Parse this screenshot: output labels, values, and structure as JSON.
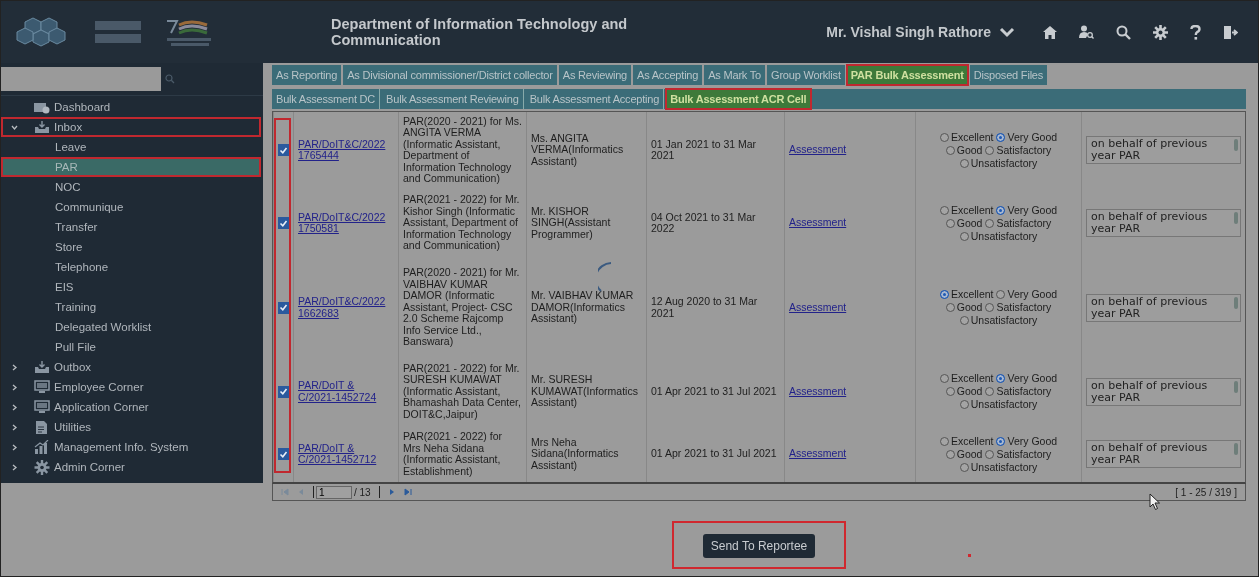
{
  "header": {
    "title": "Department of Information Technology and Communication",
    "user": "Mr. Vishal Singh Rathore"
  },
  "sidebar": {
    "items": [
      {
        "label": "Dashboard",
        "kind": "dashboard",
        "highlighted": false
      },
      {
        "label": "Inbox",
        "kind": "inbox",
        "expanded": true,
        "highlighted": true,
        "children": [
          {
            "label": "Leave",
            "selected": false,
            "highlighted": false
          },
          {
            "label": "PAR",
            "selected": true,
            "highlighted": true
          },
          {
            "label": "NOC",
            "selected": false,
            "highlighted": false
          },
          {
            "label": "Communique",
            "selected": false,
            "highlighted": false
          },
          {
            "label": "Transfer",
            "selected": false,
            "highlighted": false
          },
          {
            "label": "Store",
            "selected": false,
            "highlighted": false
          },
          {
            "label": "Telephone",
            "selected": false,
            "highlighted": false
          },
          {
            "label": "EIS",
            "selected": false,
            "highlighted": false
          },
          {
            "label": "Training",
            "selected": false,
            "highlighted": false
          },
          {
            "label": "Delegated Worklist",
            "selected": false,
            "highlighted": false
          },
          {
            "label": "Pull File",
            "selected": false,
            "highlighted": false
          }
        ]
      },
      {
        "label": "Outbox",
        "kind": "inbox",
        "expanded": false,
        "highlighted": false
      },
      {
        "label": "Employee Corner",
        "kind": "monitor",
        "expanded": false,
        "highlighted": false
      },
      {
        "label": "Application Corner",
        "kind": "monitor",
        "expanded": false,
        "highlighted": false
      },
      {
        "label": "Utilities",
        "kind": "document",
        "expanded": false,
        "highlighted": false
      },
      {
        "label": "Management Info. System",
        "kind": "chart",
        "expanded": false,
        "highlighted": false
      },
      {
        "label": "Admin Corner",
        "kind": "gear",
        "expanded": false,
        "highlighted": false
      }
    ]
  },
  "tabs": [
    {
      "label": "As Reporting",
      "selected": false,
      "highlighted": false
    },
    {
      "label": "As Divisional commissioner/District collector",
      "selected": false,
      "highlighted": false
    },
    {
      "label": "As Reviewing",
      "selected": false,
      "highlighted": false
    },
    {
      "label": "As Accepting",
      "selected": false,
      "highlighted": false
    },
    {
      "label": "As Mark To",
      "selected": false,
      "highlighted": false
    },
    {
      "label": "Group Worklist",
      "selected": false,
      "highlighted": false
    },
    {
      "label": "PAR Bulk Assessment",
      "selected": true,
      "highlighted": true
    },
    {
      "label": "Disposed Files",
      "selected": false,
      "highlighted": false
    }
  ],
  "subtabs": [
    {
      "label": "Bulk Assessment DC",
      "selected": false,
      "highlighted": false
    },
    {
      "label": "Bulk Assessment Reviewing",
      "selected": false,
      "highlighted": false
    },
    {
      "label": "Bulk Assessment Accepting",
      "selected": false,
      "highlighted": false
    },
    {
      "label": "Bulk Assessment ACR Cell",
      "selected": true,
      "highlighted": true
    }
  ],
  "table": {
    "checkbox_column_highlighted": true,
    "rows": [
      {
        "checked": true,
        "reference": "PAR/DoIT&C/2022 1765444",
        "description": "PAR(2020 - 2021) for Ms. ANGITA VERMA (Informatic Assistant, Department of Information Technology and Communication)",
        "employee": "Ms. ANGITA VERMA(Informatics Assistant)",
        "period": "01 Jan 2021 to 31 Mar 2021",
        "link": "Assessment",
        "ratings": [
          {
            "label": "Excellent",
            "selected": false
          },
          {
            "label": "Very Good",
            "selected": true
          },
          {
            "label": "Good",
            "selected": false
          },
          {
            "label": "Satisfactory",
            "selected": false
          },
          {
            "label": "Unsatisfactory",
            "selected": false
          }
        ],
        "remark": "on behalf of previous year PAR"
      },
      {
        "checked": true,
        "reference": "PAR/DoIT&C/2022 1750581",
        "description": "PAR(2021 - 2022) for Mr. Kishor Singh (Informatic Assistant, Department of Information Technology and Communication)",
        "employee": "Mr. KISHOR SINGH(Assistant Programmer)",
        "period": "04 Oct 2021 to 31 Mar 2022",
        "link": "Assessment",
        "ratings": [
          {
            "label": "Excellent",
            "selected": false
          },
          {
            "label": "Very Good",
            "selected": true
          },
          {
            "label": "Good",
            "selected": false
          },
          {
            "label": "Satisfactory",
            "selected": false
          },
          {
            "label": "Unsatisfactory",
            "selected": false
          }
        ],
        "remark": "on behalf of previous year PAR"
      },
      {
        "checked": true,
        "reference": "PAR/DoIT&C/2022 1662683",
        "description": "PAR(2020 - 2021) for Mr. VAIBHAV KUMAR DAMOR (Informatic Assistant, Project- CSC 2.0 Scheme Rajcomp Info Service Ltd., Banswara)",
        "employee": "Mr. VAIBHAV KUMAR DAMOR(Informatics Assistant)",
        "period": "12 Aug 2020 to 31 Mar 2021",
        "link": "Assessment",
        "ratings": [
          {
            "label": "Excellent",
            "selected": true
          },
          {
            "label": "Very Good",
            "selected": false
          },
          {
            "label": "Good",
            "selected": false
          },
          {
            "label": "Satisfactory",
            "selected": false
          },
          {
            "label": "Unsatisfactory",
            "selected": false
          }
        ],
        "remark": "on behalf of previous year PAR"
      },
      {
        "checked": true,
        "reference": "PAR/DoIT & C/2021-1452724",
        "description": "PAR(2021 - 2022) for Mr. SURESH KUMAWAT (Informatic Assistant, Bhamashah Data Center, DOIT&C,Jaipur)",
        "employee": "Mr. SURESH KUMAWAT(Informatics Assistant)",
        "period": "01 Apr 2021 to 31 Jul 2021",
        "link": "Assessment",
        "ratings": [
          {
            "label": "Excellent",
            "selected": false
          },
          {
            "label": "Very Good",
            "selected": true
          },
          {
            "label": "Good",
            "selected": false
          },
          {
            "label": "Satisfactory",
            "selected": false
          },
          {
            "label": "Unsatisfactory",
            "selected": false
          }
        ],
        "remark": "on behalf of previous year PAR"
      },
      {
        "checked": true,
        "reference": "PAR/DoIT & C/2021-1452712",
        "description": "PAR(2021 - 2022) for Mrs Neha Sidana (Informatic Assistant, Establishment)",
        "employee": "Mrs Neha Sidana(Informatics Assistant)",
        "period": "01 Apr 2021 to 31 Jul 2021",
        "link": "Assessment",
        "ratings": [
          {
            "label": "Excellent",
            "selected": false
          },
          {
            "label": "Very Good",
            "selected": true
          },
          {
            "label": "Good",
            "selected": false
          },
          {
            "label": "Satisfactory",
            "selected": false
          },
          {
            "label": "Unsatisfactory",
            "selected": false
          }
        ],
        "remark": "on behalf of previous year PAR"
      }
    ]
  },
  "pager": {
    "page": "1",
    "total_pages": "/ 13",
    "summary": "[ 1 - 25 / 319 ]"
  },
  "action": {
    "label": "Send To Reportee",
    "highlighted": true
  }
}
